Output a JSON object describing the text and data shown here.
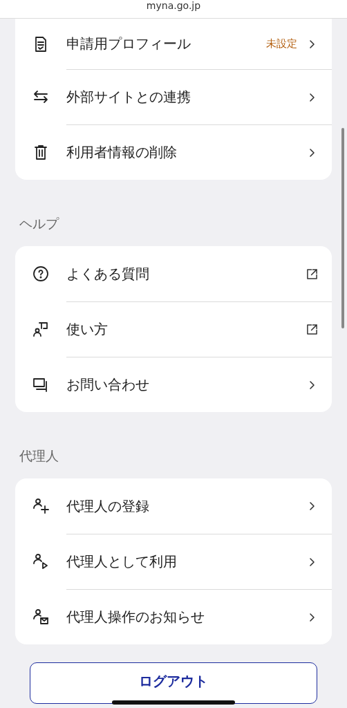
{
  "address_bar": {
    "url": "myna.go.jp"
  },
  "sections": [
    {
      "items": [
        {
          "label": "申請用プロフィール",
          "status": "未設定",
          "kind": "page"
        },
        {
          "label": "外部サイトとの連携",
          "kind": "page"
        },
        {
          "label": "利用者情報の削除",
          "kind": "page"
        }
      ]
    },
    {
      "title": "ヘルプ",
      "items": [
        {
          "label": "よくある質問",
          "kind": "external"
        },
        {
          "label": "使い方",
          "kind": "external"
        },
        {
          "label": "お問い合わせ",
          "kind": "page"
        }
      ]
    },
    {
      "title": "代理人",
      "items": [
        {
          "label": "代理人の登録",
          "kind": "page"
        },
        {
          "label": "代理人として利用",
          "kind": "page"
        },
        {
          "label": "代理人操作のお知らせ",
          "kind": "page"
        }
      ]
    }
  ],
  "logout_button": "ログアウト"
}
